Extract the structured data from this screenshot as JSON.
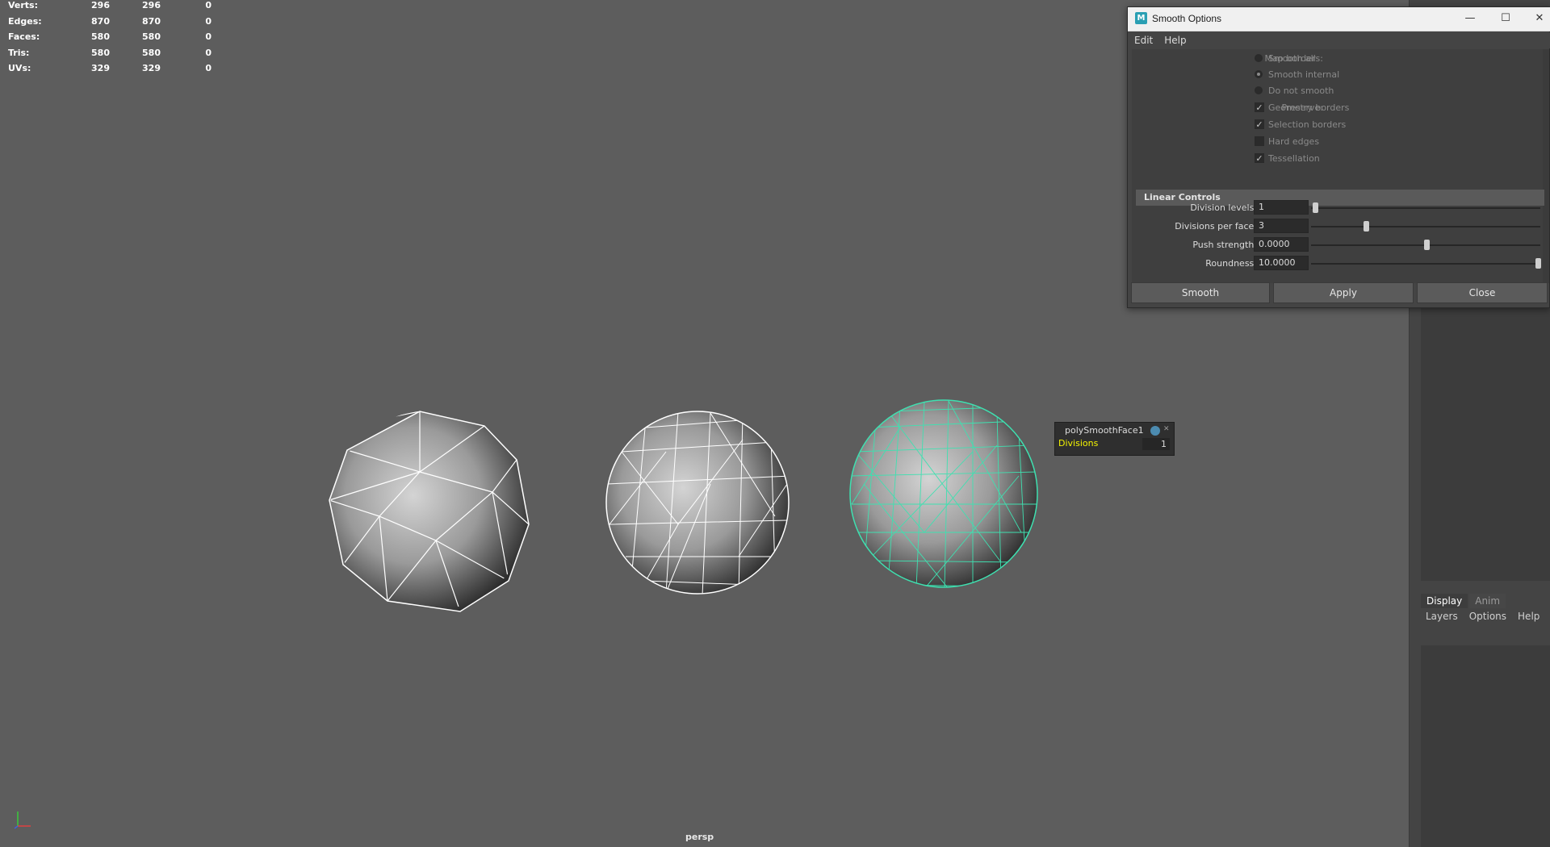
{
  "hud": {
    "rows": [
      {
        "label": "Verts:",
        "v1": "296",
        "v2": "296",
        "v3": "0"
      },
      {
        "label": "Edges:",
        "v1": "870",
        "v2": "870",
        "v3": "0"
      },
      {
        "label": "Faces:",
        "v1": "580",
        "v2": "580",
        "v3": "0"
      },
      {
        "label": "Tris:",
        "v1": "580",
        "v2": "580",
        "v3": "0"
      },
      {
        "label": "UVs:",
        "v1": "329",
        "v2": "329",
        "v3": "0"
      }
    ]
  },
  "viewport": {
    "camera": "persp"
  },
  "dialog": {
    "title": "Smooth Options",
    "menu": [
      "Edit",
      "Help"
    ],
    "map_borders_label": "Map borders:",
    "map_borders": [
      "Smooth all",
      "Smooth internal",
      "Do not smooth"
    ],
    "preserve_label": "Preserve:",
    "preserve": [
      {
        "label": "Geometry borders",
        "checked": true
      },
      {
        "label": "Selection borders",
        "checked": true
      },
      {
        "label": "Hard edges",
        "checked": false
      },
      {
        "label": "Tessellation",
        "checked": true
      }
    ],
    "section": "Linear Controls",
    "fields": [
      {
        "label": "Division levels:",
        "value": "1",
        "slider": 0.0
      },
      {
        "label": "Divisions per face:",
        "value": "3",
        "slider": 0.23
      },
      {
        "label": "Push strength:",
        "value": "0.0000",
        "slider": 0.5
      },
      {
        "label": "Roundness:",
        "value": "10.0000",
        "slider": 1.0
      }
    ],
    "buttons": [
      "Smooth",
      "Apply",
      "Close"
    ]
  },
  "hud_popup": {
    "node": "polySmoothFace1",
    "attr": "Divisions",
    "value": "1"
  },
  "side_panel": {
    "tabs": [
      "Display",
      "Anim"
    ],
    "menu": [
      "Layers",
      "Options",
      "Help"
    ]
  }
}
